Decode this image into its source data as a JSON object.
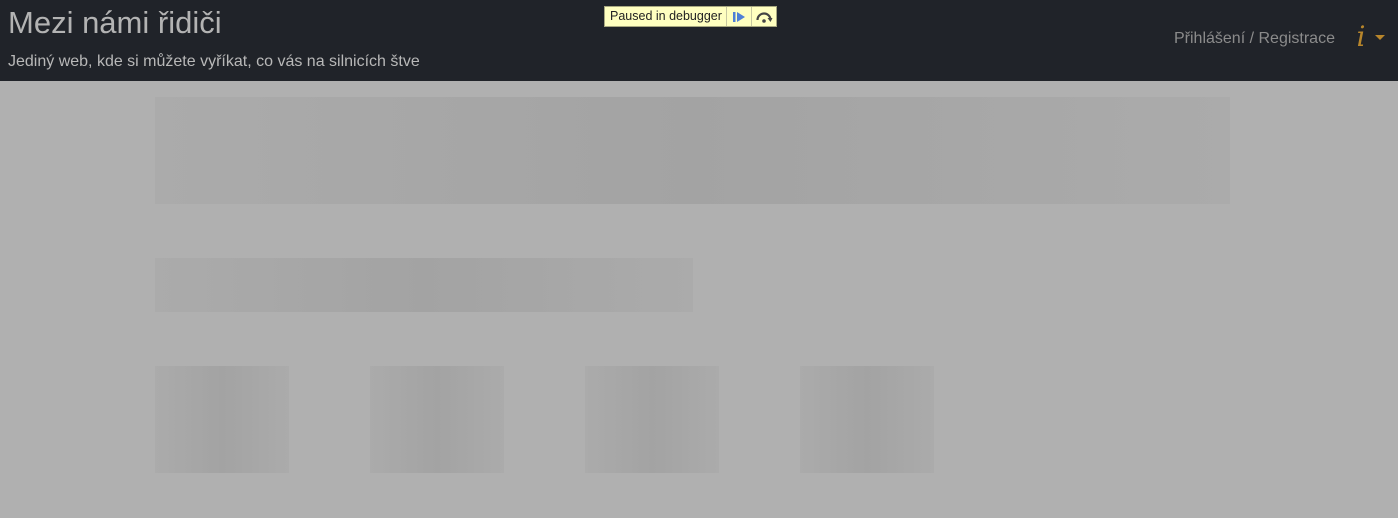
{
  "header": {
    "title": "Mezi námi řidiči",
    "subtitle": "Jediný web, kde si můžete vyříkat, co vás na silnicích štve",
    "login_label": "Přihlášení / Registrace",
    "info_menu": {
      "glyph": "i",
      "icon": "info-icon"
    }
  },
  "debugger": {
    "label": "Paused in debugger",
    "resume_icon": "resume-icon",
    "step_over_icon": "step-over-icon"
  },
  "colors": {
    "header_bg": "#202329",
    "page_overlay": "#b0b0b0",
    "accent": "#b8862b",
    "debugger_bg": "#ffffc0"
  },
  "content": {
    "state": "loading-skeleton"
  }
}
